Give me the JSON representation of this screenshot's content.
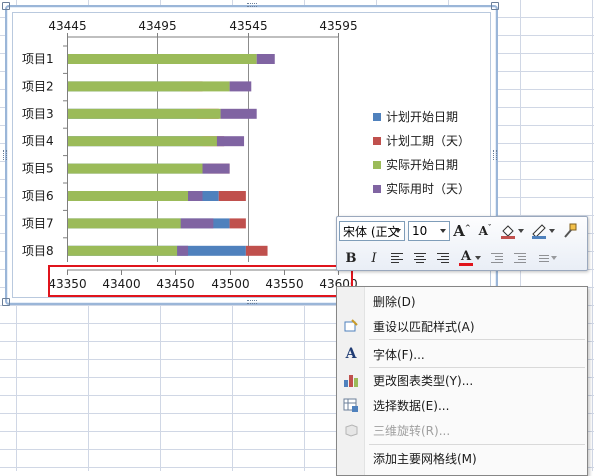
{
  "chart_data": {
    "type": "bar",
    "orientation": "horizontal",
    "stacked": true,
    "categories": [
      "项目1",
      "项目2",
      "项目3",
      "项目4",
      "项目5",
      "项目6",
      "项目7",
      "项目8"
    ],
    "series": [
      {
        "name": "计划开始日期",
        "color": "#4f81bd",
        "values": [
          43445,
          43455,
          43470,
          43475,
          43480,
          43490,
          43500,
          43515
        ]
      },
      {
        "name": "计划工期（天）",
        "color": "#c0504d",
        "values": [
          15,
          20,
          20,
          20,
          20,
          25,
          15,
          20
        ]
      },
      {
        "name": "实际开始日期",
        "color": "#9bbb59",
        "values": [
          43550,
          43535,
          43530,
          43528,
          43520,
          43512,
          43508,
          43506
        ]
      },
      {
        "name": "实际用时（天）",
        "color": "#8064a2",
        "values": [
          10,
          12,
          20,
          15,
          15,
          8,
          18,
          6
        ]
      }
    ],
    "primary_axis": {
      "ticks": [
        "43350",
        "43400",
        "43450",
        "43500",
        "43550",
        "43600"
      ],
      "range": [
        43350,
        43600
      ]
    },
    "secondary_axis": {
      "ticks": [
        "43445",
        "43495",
        "43545",
        "43595"
      ],
      "range": [
        43445,
        43595
      ]
    },
    "legend_position": "right",
    "grid": true
  },
  "mini_toolbar": {
    "font_name": "宋体 (正文",
    "font_size": "10",
    "grow_font": "A",
    "shrink_font": "A",
    "bold": "B",
    "italic": "I",
    "font_color": "A"
  },
  "context_menu": {
    "items": [
      {
        "label": "删除(D)",
        "icon": "",
        "disabled": false
      },
      {
        "label": "重设以匹配样式(A)",
        "icon": "reset-style-icon",
        "disabled": false
      },
      {
        "label": "字体(F)...",
        "icon": "font-icon",
        "disabled": false
      },
      {
        "label": "更改图表类型(Y)...",
        "icon": "chart-type-icon",
        "disabled": false
      },
      {
        "label": "选择数据(E)...",
        "icon": "select-data-icon",
        "disabled": false
      },
      {
        "label": "三维旋转(R)...",
        "icon": "3d-rotation-icon",
        "disabled": true
      },
      {
        "label": "添加主要网格线(M)",
        "icon": "",
        "disabled": false
      }
    ]
  },
  "colors": {
    "highlight": "#e0141c",
    "grid_line": "#d0d7e5"
  }
}
